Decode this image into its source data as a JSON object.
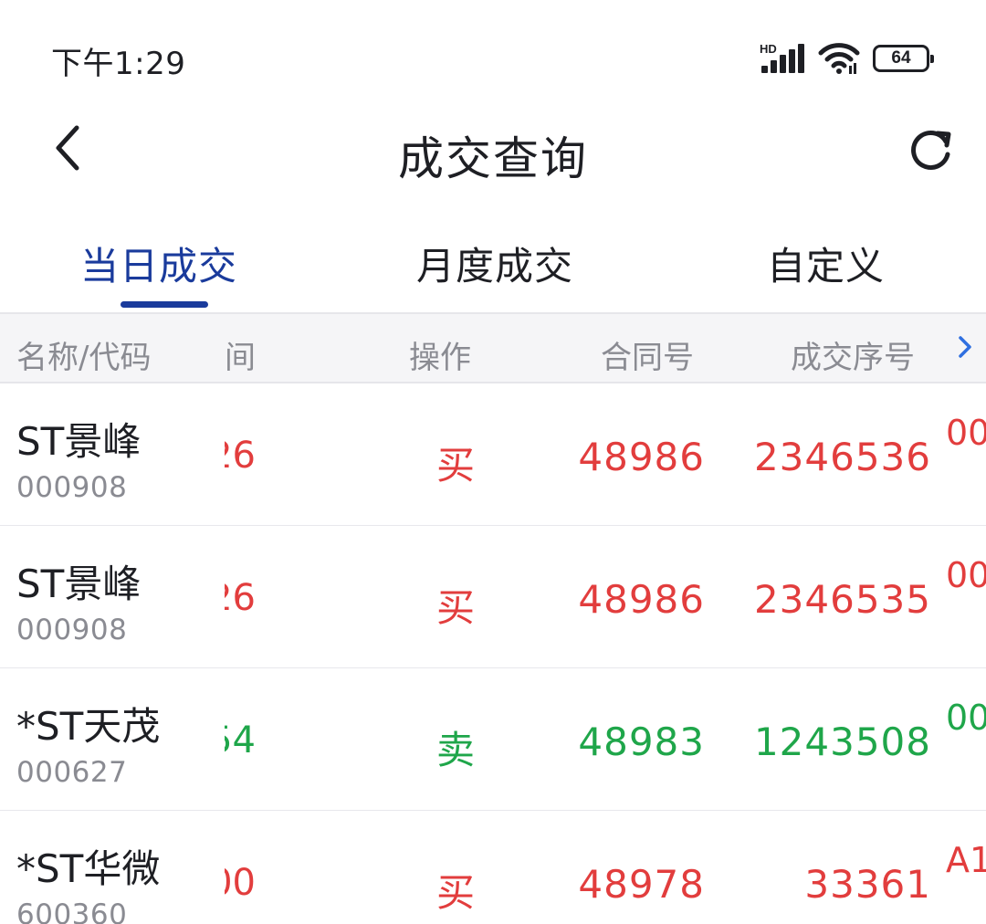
{
  "status_bar": {
    "time": "下午1:29",
    "network": "HD",
    "battery": "64"
  },
  "header": {
    "title": "成交查询",
    "back_icon": "chevron-left-icon",
    "refresh_icon": "refresh-icon"
  },
  "tabs": [
    {
      "label": "当日成交",
      "active": true
    },
    {
      "label": "月度成交",
      "active": false
    },
    {
      "label": "自定义",
      "active": false
    }
  ],
  "table": {
    "columns": {
      "name_code": "名称/代码",
      "time_partial": "间",
      "operation": "操作",
      "contract_no": "合同号",
      "trade_seq": "成交序号"
    },
    "rows": [
      {
        "name": "ST景峰",
        "code": "000908",
        "time_partial": "26",
        "operation": "买",
        "side": "buy",
        "contract_no": "48986",
        "trade_seq": "2346536",
        "next_partial": "00"
      },
      {
        "name": "ST景峰",
        "code": "000908",
        "time_partial": "26",
        "operation": "买",
        "side": "buy",
        "contract_no": "48986",
        "trade_seq": "2346535",
        "next_partial": "00"
      },
      {
        "name": "*ST天茂",
        "code": "000627",
        "time_partial": "54",
        "operation": "卖",
        "side": "sell",
        "contract_no": "48983",
        "trade_seq": "1243508",
        "next_partial": "00"
      },
      {
        "name": "*ST华微",
        "code": "600360",
        "time_partial": "00",
        "operation": "买",
        "side": "buy",
        "contract_no": "48978",
        "trade_seq": "33361",
        "next_partial": "A1"
      }
    ]
  },
  "colors": {
    "accent": "#1a3b9c",
    "buy": "#e23d3d",
    "sell": "#1fa64a",
    "header_bg": "#f5f5f7",
    "muted_text": "#8a8b92"
  }
}
